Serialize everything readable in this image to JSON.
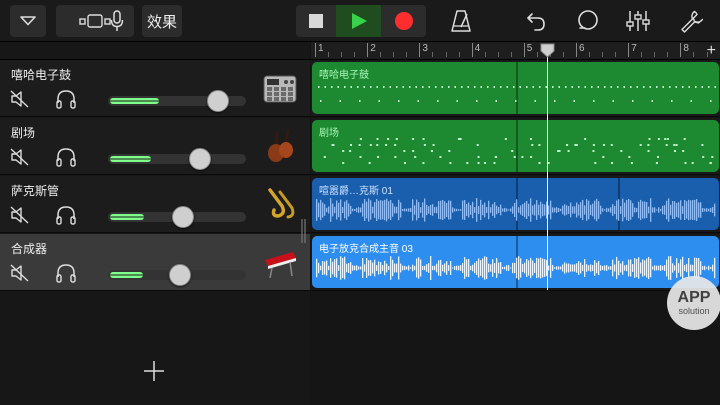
{
  "toolbar": {
    "fx_label": "效果",
    "colors": {
      "play": "#37d24a",
      "record": "#ff2e2e",
      "box": "#2c2c2c"
    }
  },
  "ruler": {
    "bars": [
      "1",
      "2",
      "3",
      "4",
      "5",
      "6",
      "7",
      "8"
    ],
    "add_label": "+"
  },
  "tracks": [
    {
      "name": "嘻哈电子鼓",
      "volume": 0.85,
      "instrument_icon": "drum-machine-icon",
      "selected": false
    },
    {
      "name": "剧场",
      "volume": 0.7,
      "instrument_icon": "strings-icon",
      "selected": false
    },
    {
      "name": "萨克斯管",
      "volume": 0.55,
      "instrument_icon": "saxophone-icon",
      "selected": false
    },
    {
      "name": "合成器",
      "volume": 0.53,
      "instrument_icon": "keyboard-synth-icon",
      "selected": true
    }
  ],
  "regions": [
    {
      "lane": 0,
      "title": "嘻哈电子鼓",
      "style": "green",
      "type": "midi"
    },
    {
      "lane": 1,
      "title": "剧场",
      "style": "green",
      "type": "midi"
    },
    {
      "lane": 2,
      "title": "喧嚣爵…克斯 01",
      "style": "darkblue",
      "type": "audio"
    },
    {
      "lane": 3,
      "title": "电子放克合成主音 03",
      "style": "blue",
      "type": "audio"
    }
  ],
  "playhead_bar": 5.45,
  "add_track_label": "+",
  "watermark": {
    "big": "APP",
    "small": "solution"
  }
}
